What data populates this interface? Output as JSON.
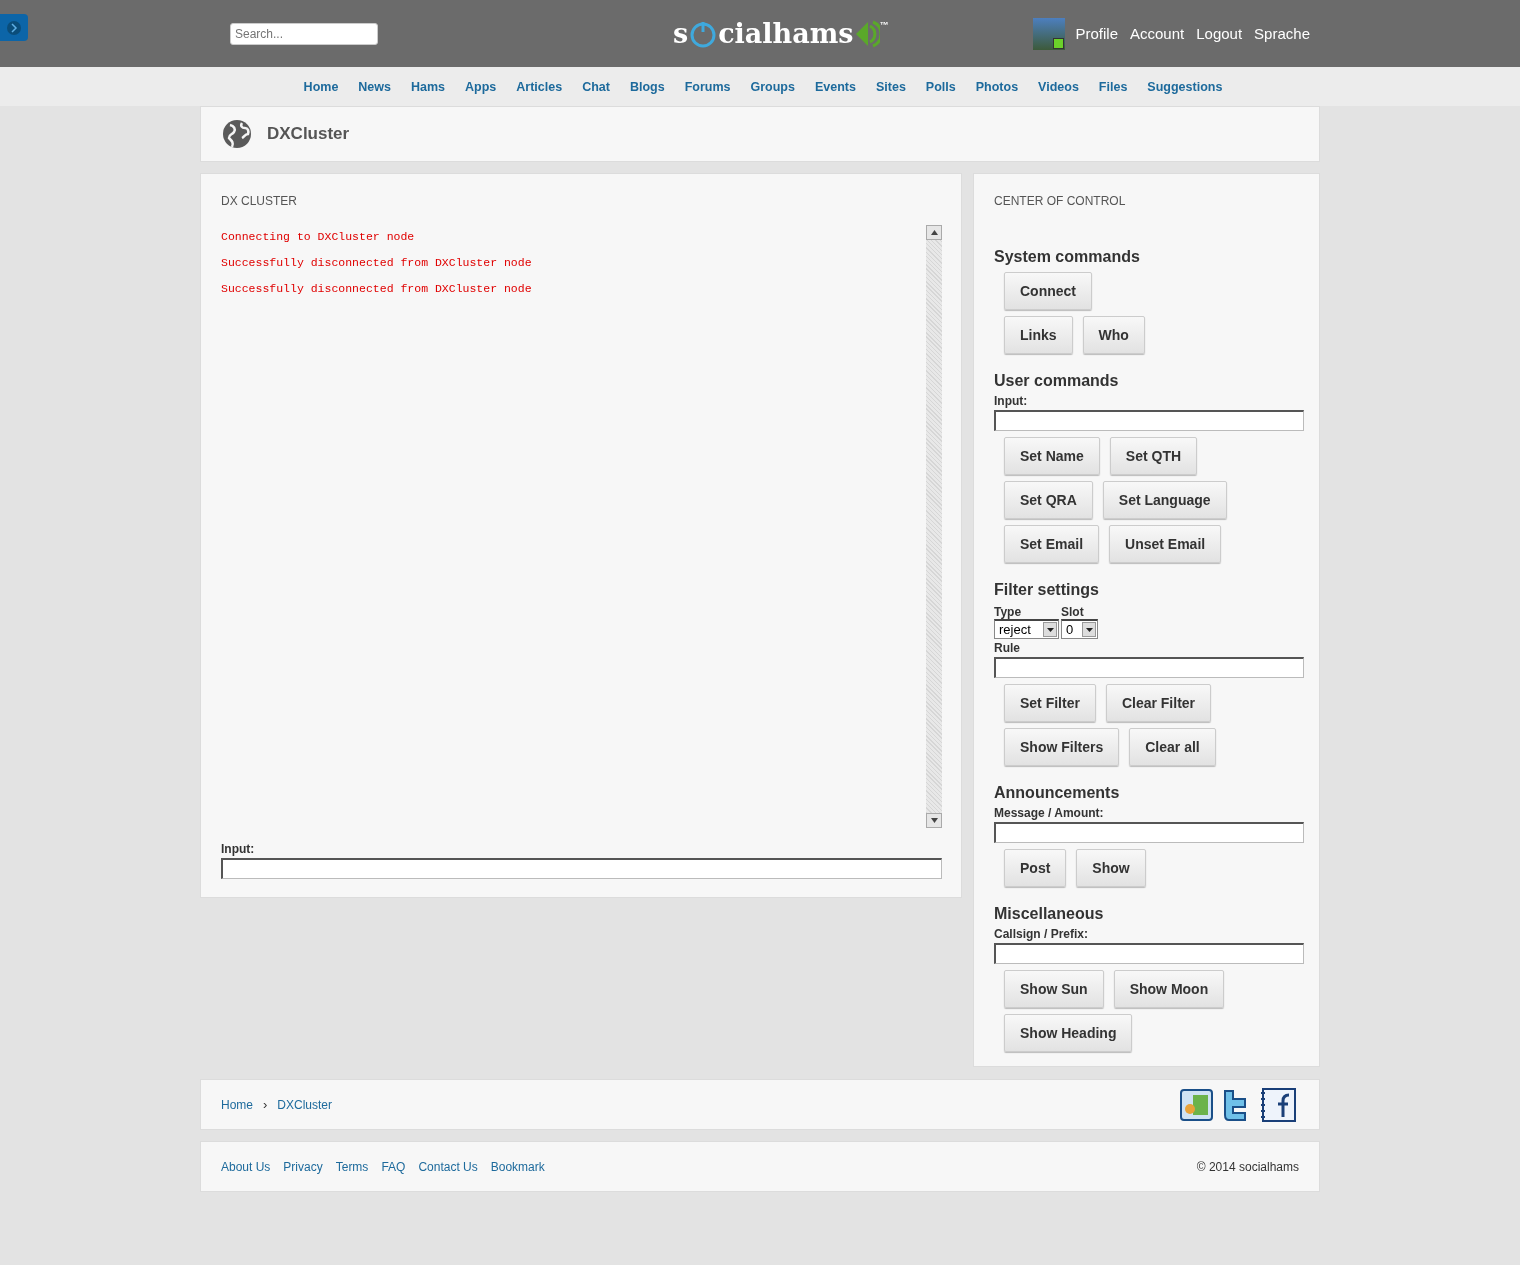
{
  "header": {
    "search": {
      "placeholder": "Search..."
    },
    "logo": {
      "before": "s",
      "after": "cialhams",
      "mark": "™"
    },
    "user_links": [
      "Profile",
      "Account",
      "Logout",
      "Sprache"
    ]
  },
  "nav": [
    "Home",
    "News",
    "Hams",
    "Apps",
    "Articles",
    "Chat",
    "Blogs",
    "Forums",
    "Groups",
    "Events",
    "Sites",
    "Polls",
    "Photos",
    "Videos",
    "Files",
    "Suggestions"
  ],
  "page_title": "DXCluster",
  "console": {
    "title": "DX CLUSTER",
    "lines": [
      "Connecting to DXCluster node",
      "Successfully disconnected from DXCluster node",
      "Successfully disconnected from DXCluster node"
    ],
    "input_label": "Input:"
  },
  "control": {
    "title": "CENTER OF CONTROL",
    "sections": [
      {
        "heading": "System commands",
        "items": [
          {
            "kind": "buttons",
            "buttons": [
              "Connect"
            ]
          },
          {
            "kind": "buttons",
            "buttons": [
              "Links",
              "Who"
            ]
          }
        ]
      },
      {
        "heading": "User commands",
        "items": [
          {
            "kind": "field",
            "label": "Input:"
          },
          {
            "kind": "buttons",
            "buttons": [
              "Set Name",
              "Set QTH"
            ]
          },
          {
            "kind": "buttons",
            "buttons": [
              "Set QRA",
              "Set Language"
            ]
          },
          {
            "kind": "buttons",
            "buttons": [
              "Set Email",
              "Unset Email"
            ]
          }
        ]
      },
      {
        "heading": "Filter settings",
        "items": [
          {
            "kind": "selects",
            "selects": [
              {
                "label": "Type",
                "value": "reject"
              },
              {
                "label": "Slot",
                "value": "0"
              }
            ]
          },
          {
            "kind": "field",
            "label": "Rule"
          },
          {
            "kind": "buttons",
            "buttons": [
              "Set Filter",
              "Clear Filter"
            ]
          },
          {
            "kind": "buttons",
            "buttons": [
              "Show Filters",
              "Clear all"
            ]
          }
        ]
      },
      {
        "heading": "Announcements",
        "items": [
          {
            "kind": "field",
            "label": "Message / Amount:"
          },
          {
            "kind": "buttons",
            "buttons": [
              "Post",
              "Show"
            ]
          }
        ]
      },
      {
        "heading": "Miscellaneous",
        "items": [
          {
            "kind": "field",
            "label": "Callsign / Prefix:"
          },
          {
            "kind": "buttons",
            "buttons": [
              "Show Sun",
              "Show Moon"
            ]
          },
          {
            "kind": "buttons",
            "buttons": [
              "Show Heading"
            ]
          }
        ]
      }
    ]
  },
  "breadcrumb": [
    "Home",
    "DXCluster"
  ],
  "breadcrumb_separator": "›",
  "social": [
    {
      "kind": "googleplus"
    },
    {
      "kind": "twitter"
    },
    {
      "kind": "facebook"
    }
  ],
  "footer": {
    "links": [
      "About Us",
      "Privacy",
      "Terms",
      "FAQ",
      "Contact Us",
      "Bookmark"
    ],
    "copyright": "© 2014 socialhams"
  }
}
